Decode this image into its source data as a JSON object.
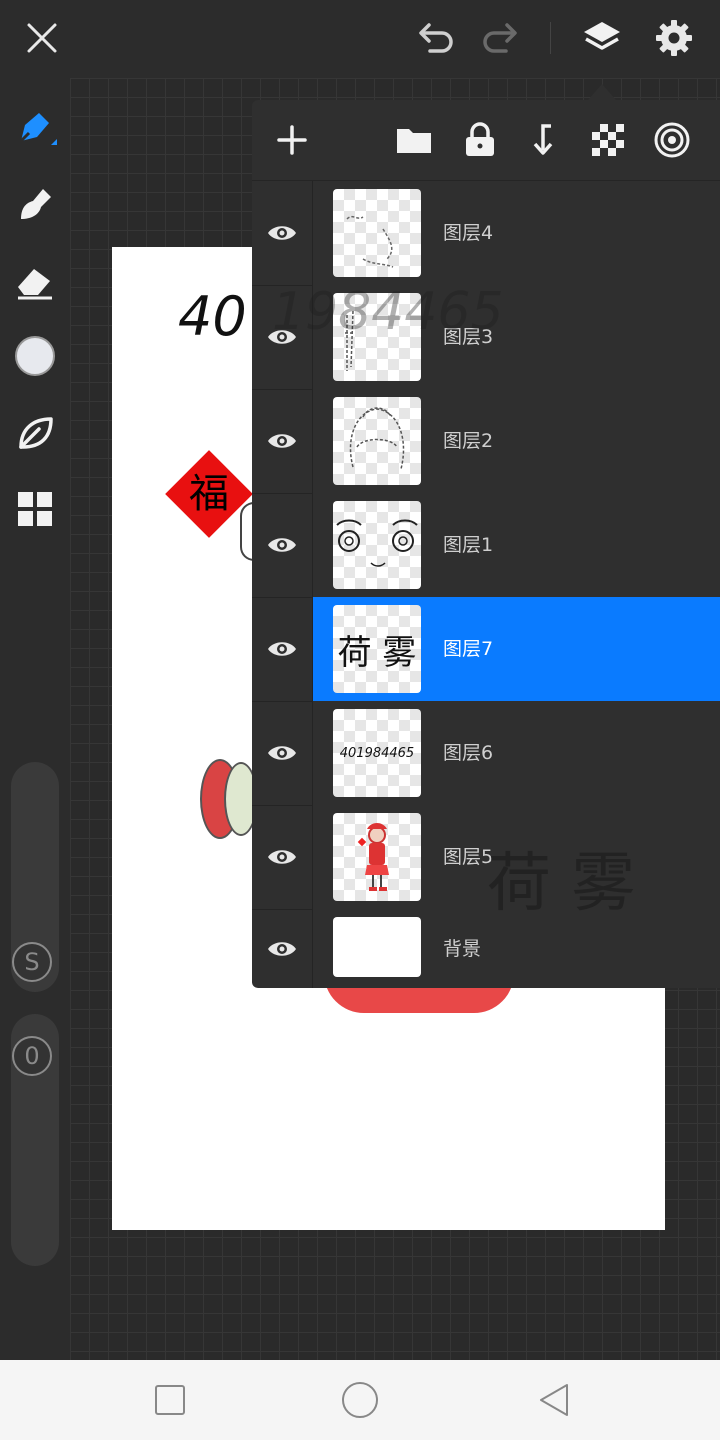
{
  "topbar": {
    "icons": [
      "close-icon",
      "undo-icon",
      "redo-icon",
      "layers-icon",
      "settings-icon"
    ]
  },
  "tools": {
    "items": [
      "pen-tool-icon",
      "smudge-tool-icon",
      "eraser-tool-icon",
      "color-picker",
      "leaf-brush-icon",
      "gallery-grid-icon"
    ],
    "size_slider_label": "S",
    "opacity_slider_label": "0"
  },
  "canvas": {
    "paper_number": "40",
    "fu_character": "福"
  },
  "layers_panel": {
    "toolbar_icons": [
      "add-layer-icon",
      "folder-icon",
      "lock-icon",
      "merge-down-icon",
      "transparency-icon",
      "layer-blend-icon"
    ],
    "layers": [
      {
        "name": "图层4",
        "thumb": "",
        "selected": false
      },
      {
        "name": "图层3",
        "thumb": "",
        "selected": false
      },
      {
        "name": "图层2",
        "thumb": "",
        "selected": false
      },
      {
        "name": "图层1",
        "thumb": "",
        "selected": false
      },
      {
        "name": "图层7",
        "thumb": "荷 雾",
        "selected": true
      },
      {
        "name": "图层6",
        "thumb": "401984465",
        "selected": false
      },
      {
        "name": "图层5",
        "thumb": "",
        "selected": false
      },
      {
        "name": "背景",
        "thumb": "",
        "selected": false
      }
    ],
    "watermark_text": "荷 雾",
    "watermark_number": "1984465"
  },
  "colors": {
    "accent": "#0a7bff",
    "panel": "#2f2f2f",
    "background": "#2c2c2c"
  },
  "navbar": {
    "icons": [
      "recent-apps-icon",
      "home-icon",
      "back-icon"
    ]
  }
}
